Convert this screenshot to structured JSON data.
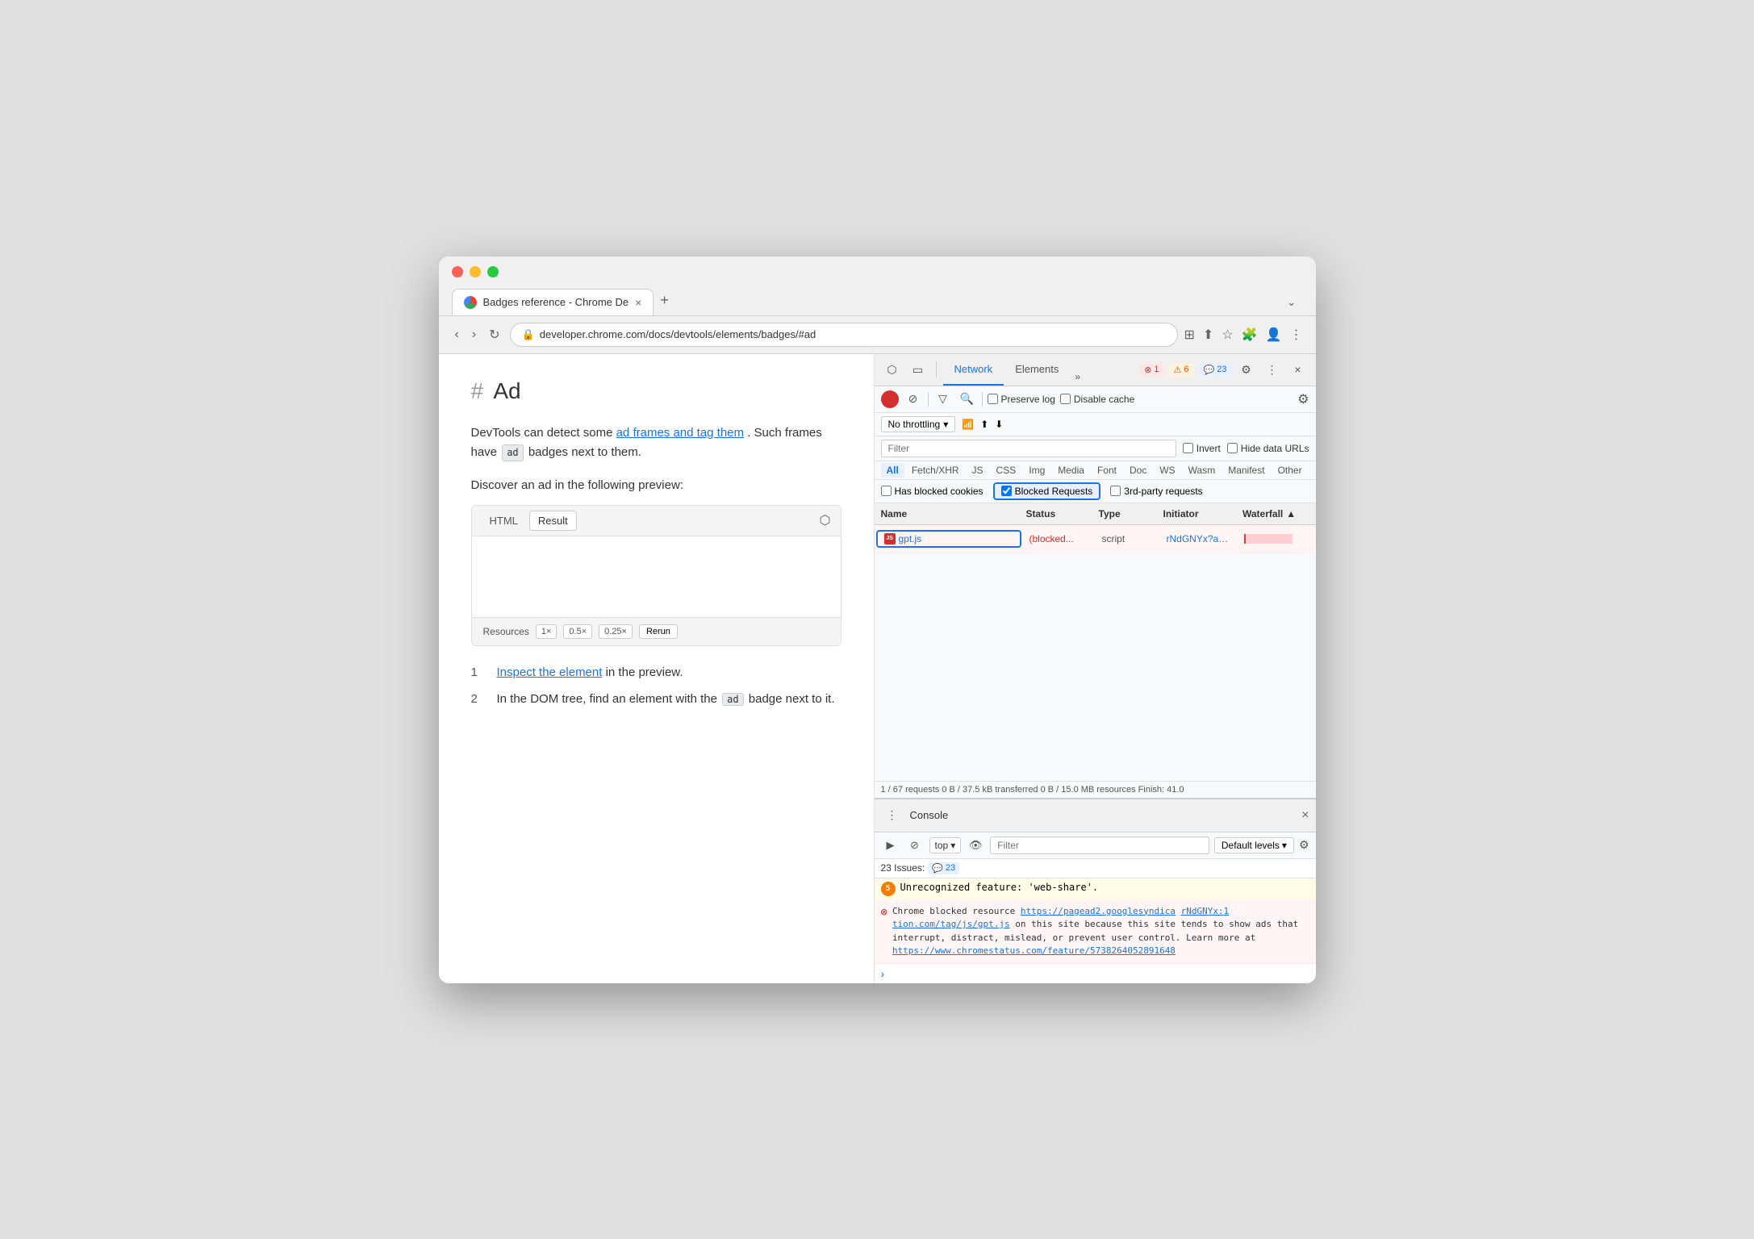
{
  "browser": {
    "tab_title": "Badges reference - Chrome De",
    "tab_close": "×",
    "tab_new": "+",
    "tab_menu": "⌄",
    "url": "developer.chrome.com/docs/devtools/elements/badges/#ad",
    "nav_back": "‹",
    "nav_forward": "›",
    "nav_reload": "↻"
  },
  "page": {
    "hash_symbol": "#",
    "heading": "Ad",
    "body_text_1": "DevTools can detect some ",
    "link_1": "ad frames and tag them",
    "body_text_2": ". Such frames have",
    "badge_ad": "ad",
    "body_text_3": "badges next to them.",
    "discover_text": "Discover an ad in the following preview:",
    "tab_html": "HTML",
    "tab_result": "Result",
    "footer_resources": "Resources",
    "mult_1x": "1×",
    "mult_05x": "0.5×",
    "mult_025x": "0.25×",
    "rerun": "Rerun",
    "steps": [
      {
        "num": "1",
        "text_before": "",
        "link": "Inspect the element",
        "text_after": " in the preview."
      },
      {
        "num": "2",
        "text_before": "In the DOM tree, find an element with the",
        "badge": "ad",
        "text_after": "badge next to it."
      }
    ]
  },
  "devtools": {
    "cursor_icon": "⬡",
    "device_icon": "▭",
    "tabs": [
      "Network",
      "Elements"
    ],
    "active_tab": "Network",
    "more_tabs": "»",
    "badge_error": "1",
    "badge_warn": "6",
    "badge_info": "23",
    "settings_icon": "⚙",
    "more_icon": "⋮",
    "close_icon": "×",
    "network": {
      "record_btn": "",
      "stop_btn": "⊘",
      "filter_icon": "▽",
      "search_icon": "🔍",
      "preserve_log_label": "Preserve log",
      "disable_cache_label": "Disable cache",
      "settings_icon": "⚙",
      "throttle_label": "No throttling",
      "wifi_icon": "📶",
      "upload_icon": "⬆",
      "download_icon": "⬇",
      "filter_placeholder": "Filter",
      "invert_label": "Invert",
      "hide_data_urls_label": "Hide data URLs",
      "type_filters": [
        "All",
        "Fetch/XHR",
        "JS",
        "CSS",
        "Img",
        "Media",
        "Font",
        "Doc",
        "WS",
        "Wasm",
        "Manifest",
        "Other"
      ],
      "active_type": "All",
      "has_blocked_cookies_label": "Has blocked cookies",
      "blocked_requests_label": "Blocked Requests",
      "third_party_label": "3rd-party requests",
      "columns": {
        "name": "Name",
        "status": "Status",
        "type": "Type",
        "initiator": "Initiator",
        "waterfall": "Waterfall"
      },
      "rows": [
        {
          "name": "gpt.js",
          "status": "(blocked...",
          "type": "script",
          "initiator": "rNdGNYx?anima...",
          "highlighted": true
        }
      ],
      "status_bar": "1 / 67 requests   0 B / 37.5 kB transferred   0 B / 15.0 MB resources   Finish: 41.0"
    },
    "console": {
      "title": "Console",
      "close_icon": "×",
      "run_icon": "▶",
      "stop_icon": "⊘",
      "top_label": "top",
      "eye_icon": "👁",
      "filter_placeholder": "Filter",
      "default_levels_label": "Default levels",
      "gear_icon": "⚙",
      "issues_label": "23 Issues:",
      "issues_count": "23",
      "messages": [
        {
          "type": "warn",
          "count": "5",
          "text": "Unrecognized feature: 'web-share'."
        },
        {
          "type": "error",
          "text_parts": [
            "Chrome blocked resource ",
            "https://pagead2.googlesyndi",
            "rNdGNYx:1",
            "\nca\ntion.com/tag/js/gpt.js",
            " on this site because this site tends to show ads that interrupt, distract, mislead, or prevent user control. Learn more at ",
            "https://www.chromestatus.com/feature/5738264052891648"
          ]
        }
      ],
      "prompt_arrow": ">"
    }
  }
}
